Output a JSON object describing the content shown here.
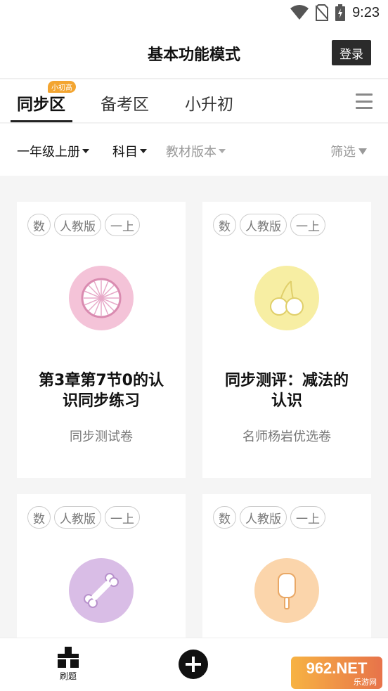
{
  "status_bar": {
    "time": "9:23",
    "icons": [
      "wifi-icon",
      "no-sim-icon",
      "battery-charging-icon"
    ]
  },
  "header": {
    "title": "基本功能模式",
    "login_label": "登录"
  },
  "tabs": {
    "items": [
      {
        "label": "同步区",
        "active": true,
        "badge": "小初高"
      },
      {
        "label": "备考区",
        "active": false
      },
      {
        "label": "小升初",
        "active": false
      }
    ],
    "menu_icon": "hamburger-menu-icon"
  },
  "filters": {
    "grade": "一年级上册",
    "subject": "科目",
    "edition": "教材版本",
    "filter": "筛选"
  },
  "cards": [
    {
      "tags": [
        "数",
        "人教版",
        "一上"
      ],
      "icon": "citrus-slice-icon",
      "icon_color": "#f4c3d8",
      "title": "第3章第7节0的认识同步练习",
      "title_line1": "第3章第7节0的认",
      "title_line2": "识同步练习",
      "subtitle": "同步测试卷"
    },
    {
      "tags": [
        "数",
        "人教版",
        "一上"
      ],
      "icon": "cherries-icon",
      "icon_color": "#f7eea3",
      "title_line1": "同步测评：减法的",
      "title_line2": "认识",
      "subtitle": "名师杨岩优选卷"
    },
    {
      "tags": [
        "数",
        "人教版",
        "一上"
      ],
      "icon": "bone-icon",
      "icon_color": "#d9bde6",
      "title_line1": "",
      "title_line2": "",
      "subtitle": ""
    },
    {
      "tags": [
        "数",
        "人教版",
        "一上"
      ],
      "icon": "popsicle-icon",
      "icon_color": "#fbd5ab",
      "title_line1": "",
      "title_line2": "",
      "subtitle": ""
    }
  ],
  "bottom_nav": {
    "practice_label": "刷题",
    "add_icon": "plus-circle-icon",
    "watermark": "962.NET",
    "watermark_sub": "乐游网"
  },
  "colors": {
    "accent": "#f3a531",
    "dark": "#2b2b2b",
    "background": "#f5f5f5"
  }
}
